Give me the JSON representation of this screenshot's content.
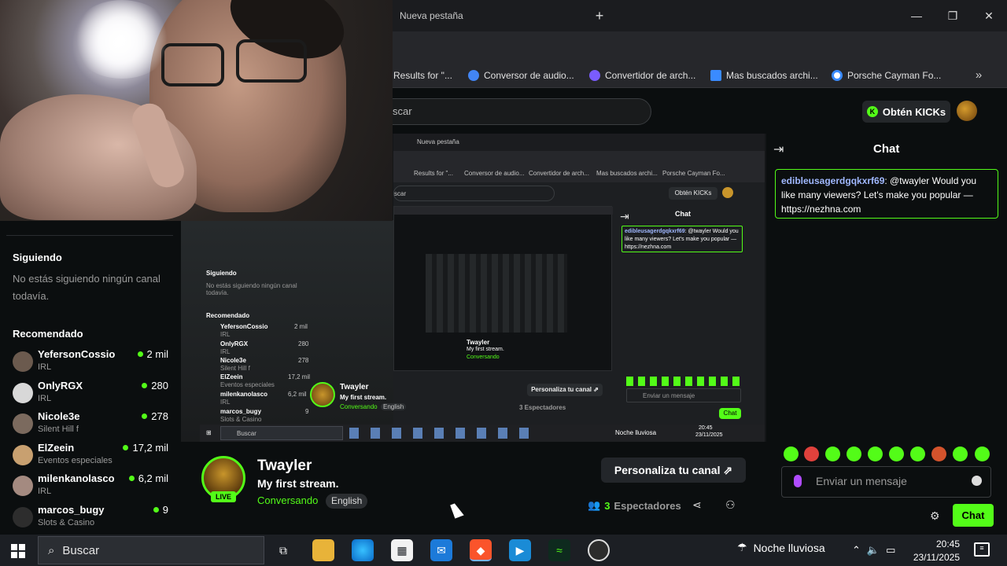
{
  "browser": {
    "tab_title": "Nueva pestaña",
    "new_tab_icon": "+",
    "minimize": "—",
    "maximize": "❐",
    "close": "✕"
  },
  "bookmarks": [
    {
      "label": "Results for \"...",
      "color": "#3a3d40"
    },
    {
      "label": "Conversor de audio...",
      "color": "#4285f4"
    },
    {
      "label": "Convertidor de arch...",
      "color": "#7a5cff"
    },
    {
      "label": "Mas buscados archi...",
      "color": "#3a8bff"
    },
    {
      "label": "Porsche Cayman Fo...",
      "color": "#ffffff"
    }
  ],
  "site": {
    "search_placeholder": "scar",
    "kicks_button": "Obtén KICKs"
  },
  "sidebar": {
    "following_heading": "Siguiendo",
    "following_empty": "No estás siguiendo ningún canal todavía.",
    "recommended_heading": "Recomendado",
    "channels": [
      {
        "name": "YefersonCossio",
        "category": "IRL",
        "viewers": "2 mil",
        "avatar_color": "#6b5a4e"
      },
      {
        "name": "OnlyRGX",
        "category": "IRL",
        "viewers": "280",
        "avatar_color": "#d8d8d8"
      },
      {
        "name": "Nicole3e",
        "category": "Silent Hill f",
        "viewers": "278",
        "avatar_color": "#7b6a5e"
      },
      {
        "name": "ElZeein",
        "category": "Eventos especiales",
        "viewers": "17,2 mil",
        "avatar_color": "#c8a070"
      },
      {
        "name": "milenkanolasco",
        "category": "IRL",
        "viewers": "6,2 mil",
        "avatar_color": "#a48a80"
      },
      {
        "name": "marcos_bugy",
        "category": "Slots & Casino",
        "viewers": "9",
        "avatar_color": "#2d2d2d"
      }
    ]
  },
  "stream": {
    "streamer": "Twayler",
    "title": "My first stream.",
    "category": "Conversando",
    "language": "English",
    "live_badge": "LIVE",
    "customize_button": "Personaliza tu canal ⇗",
    "viewers_count": "3",
    "viewers_label": "Espectadores"
  },
  "nested": {
    "tab": "Nueva pestaña",
    "bm1": "Results for \"...",
    "bm2": "Conversor de audio...",
    "bm3": "Convertidor de arch...",
    "bm4": "Mas buscados archi...",
    "bm5": "Porsche Cayman Fo...",
    "search": "scar",
    "kicks": "Obtén KICKs",
    "chat_title": "Chat",
    "chat_msg_user": "edibleusagerdgqkxrf69",
    "chat_msg_text": ": @twayler Would you like many viewers? Let's make you popular — https://nezhna.com",
    "siguiendo": "Siguiendo",
    "siguiendo_empty": "No estás siguiendo ningún canal todavía.",
    "recomendado": "Recomendado",
    "streamer": "Twayler",
    "title": "My first stream.",
    "category": "Conversando",
    "language": "English",
    "customize": "Personaliza tu canal ⇗",
    "viewers": "3 Espectadores",
    "chat_placeholder": "Enviar un mensaje",
    "chat_button": "Chat",
    "taskbar_search": "Buscar",
    "weather": "Noche lluviosa",
    "time": "20:45",
    "date": "23/11/2025",
    "rec": [
      {
        "name": "YefersonCossio",
        "cat": "IRL",
        "v": "2 mil"
      },
      {
        "name": "OnlyRGX",
        "cat": "IRL",
        "v": "280"
      },
      {
        "name": "Nicole3e",
        "cat": "Silent Hill f",
        "v": "278"
      },
      {
        "name": "ElZeein",
        "cat": "Eventos especiales",
        "v": "17,2 mil"
      },
      {
        "name": "milenkanolasco",
        "cat": "IRL",
        "v": "6,2 mil"
      },
      {
        "name": "marcos_bugy",
        "cat": "Slots & Casino",
        "v": "9"
      }
    ]
  },
  "chat": {
    "title": "Chat",
    "message_user": "edibleusagerdgqkxrf69",
    "message_text": ": @twayler Would you like many viewers? Let's make you popular — https://nezhna.com",
    "input_placeholder": "Enviar un mensaje",
    "send_button": "Chat",
    "emote_colors": [
      "#53fc18",
      "#e0413c",
      "#53fc18",
      "#53fc18",
      "#53fc18",
      "#53fc18",
      "#53fc18",
      "#d4532c",
      "#53fc18",
      "#53fc18"
    ]
  },
  "taskbar": {
    "search_text": "Buscar",
    "weather": "Noche lluviosa",
    "time": "20:45",
    "date": "23/11/2025"
  },
  "colors": {
    "accent": "#53fc18",
    "background": "#0b0e0f"
  }
}
